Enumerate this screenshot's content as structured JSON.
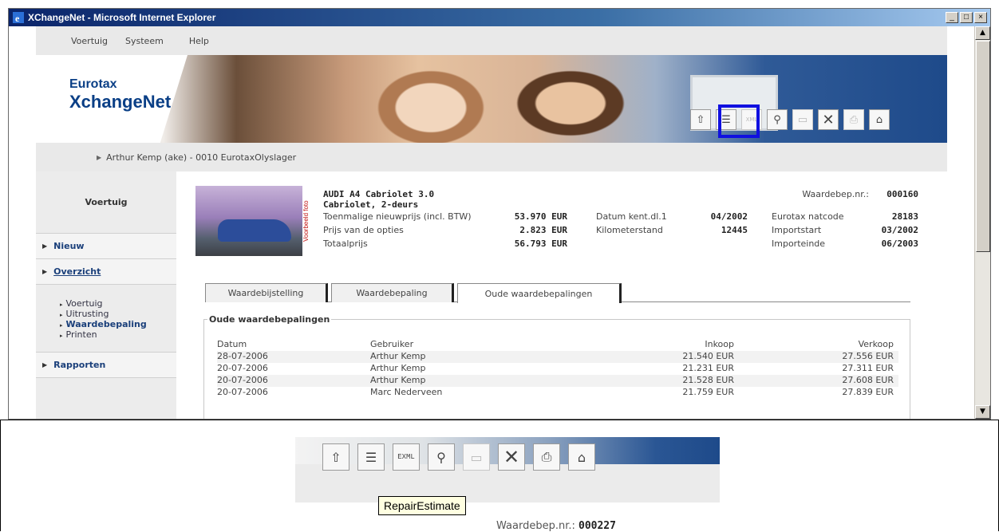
{
  "window": {
    "title": "XChangeNet - Microsoft Internet Explorer",
    "min": "_",
    "max": "□",
    "close": "×"
  },
  "menu": {
    "items": [
      "Voertuig",
      "Systeem",
      "Help"
    ]
  },
  "logo": {
    "line1": "Eurotax",
    "line2": "XchangeNet"
  },
  "user": {
    "text": "Arthur Kemp (ake) - 0010 EurotaxOlyslager"
  },
  "toolbar": {
    "icons": [
      "upload-car-icon",
      "repair-estimate-icon",
      "xml-icon",
      "magnifier-icon",
      "save-icon",
      "delete-icon",
      "print-icon",
      "home-icon"
    ],
    "xml_label": "XML"
  },
  "leftnav": {
    "header": "Voertuig",
    "new": "Nieuw",
    "overview": "Overzicht",
    "sub": [
      "Voertuig",
      "Uitrusting",
      "Waardebepaling",
      "Printen"
    ],
    "reports": "Rapporten"
  },
  "vehicle": {
    "photo_tag": "Voorbeeld foto",
    "name": "AUDI A4 Cabriolet 3.0",
    "body": "Cabriolet, 2-deurs",
    "waardebep_label": "Waardebep.nr.:",
    "waardebep_value": "000160",
    "prices": [
      {
        "label": "Toenmalige nieuwprijs (incl. BTW)",
        "value": "53.970 EUR"
      },
      {
        "label": "Prijs van de opties",
        "value": "2.823 EUR"
      },
      {
        "label": "Totaalprijs",
        "value": "56.793 EUR"
      }
    ],
    "mid": [
      {
        "label": "Datum kent.dl.1",
        "value": "04/2002"
      },
      {
        "label": "Kilometerstand",
        "value": "12445"
      }
    ],
    "right": [
      {
        "label": "Eurotax natcode",
        "value": "28183"
      },
      {
        "label": "Importstart",
        "value": "03/2002"
      },
      {
        "label": "Importeinde",
        "value": "06/2003"
      }
    ]
  },
  "tabs": [
    "Waardebijstelling",
    "Waardebepaling",
    "Oude waardebepalingen"
  ],
  "history": {
    "legend": "Oude waardebepalingen",
    "headers": [
      "Datum",
      "Gebruiker",
      "Inkoop",
      "Verkoop"
    ],
    "rows": [
      [
        "28-07-2006",
        "Arthur Kemp",
        "21.540 EUR",
        "27.556 EUR"
      ],
      [
        "20-07-2006",
        "Arthur Kemp",
        "21.231 EUR",
        "27.311 EUR"
      ],
      [
        "20-07-2006",
        "Arthur Kemp",
        "21.528 EUR",
        "27.608 EUR"
      ],
      [
        "20-07-2006",
        "Marc Nederveen",
        "21.759 EUR",
        "27.839 EUR"
      ]
    ]
  },
  "zoom": {
    "tooltip": "RepairEstimate",
    "waardebep_label": "Waardebep.nr.:",
    "waardebep_value": "000227",
    "xml_label": "EXML"
  },
  "colors": {
    "highlight": "#1010e0",
    "nav_link": "#1a3f7a",
    "titlebar": "#0a246a"
  }
}
